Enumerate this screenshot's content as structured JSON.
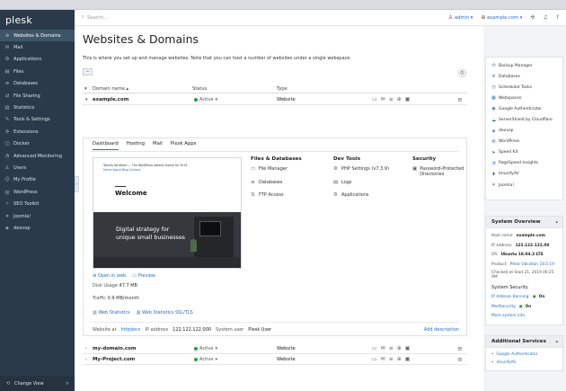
{
  "app": {
    "logo": "plesk"
  },
  "sidebar": {
    "items": [
      {
        "label": "Websites & Domains",
        "icon": "globe-icon",
        "active": true
      },
      {
        "label": "Mail",
        "icon": "mail-icon"
      },
      {
        "label": "Applications",
        "icon": "applications-icon"
      },
      {
        "label": "Files",
        "icon": "files-icon"
      },
      {
        "label": "Databases",
        "icon": "database-icon"
      },
      {
        "label": "File Sharing",
        "icon": "share-icon"
      },
      {
        "label": "Statistics",
        "icon": "statistics-icon"
      },
      {
        "label": "Tools & Settings",
        "icon": "tools-icon"
      },
      {
        "label": "Extensions",
        "icon": "extensions-icon"
      },
      {
        "label": "Docker",
        "icon": "docker-icon"
      },
      {
        "label": "Advanced Monitoring",
        "icon": "monitoring-icon"
      },
      {
        "label": "Users",
        "icon": "users-icon"
      },
      {
        "label": "My Profile",
        "icon": "profile-icon"
      },
      {
        "label": "WordPress",
        "icon": "wordpress-icon"
      },
      {
        "label": "SEO Toolkit",
        "icon": "seo-icon"
      },
      {
        "label": "Joomla!",
        "icon": "joomla-icon"
      },
      {
        "label": "dexvop",
        "icon": "dexvop-icon"
      }
    ],
    "footer_label": "Change View"
  },
  "header": {
    "search_placeholder": "Search...",
    "user": "admin",
    "domain": "example.com"
  },
  "main": {
    "title": "Websites & Domains",
    "intro": "This is where you set up and manage websites. Note that you can host a number of websites under a single webspace.",
    "columns": {
      "name": "Domain name ▴",
      "status": "Status",
      "type": "Type"
    },
    "domains": [
      {
        "name": "example.com",
        "status": "Active",
        "type": "Website",
        "expanded": true
      },
      {
        "name": "my-domain.com",
        "status": "Active",
        "type": "Website"
      },
      {
        "name": "My-Project.com",
        "status": "Active",
        "type": "Website"
      }
    ],
    "panel": {
      "tabs": [
        "Dashboard",
        "Hosting",
        "Mail",
        "Plesk Apps"
      ],
      "preview": {
        "brand": "Twenty Nineteen — The WordPress default theme for 2019",
        "nav": "Home  About  Blog  Contact",
        "welcome": "Welcome",
        "tagline1": "Digital strategy for",
        "tagline2": "unique small businesses"
      },
      "open_in_web": "Open in web",
      "preview_link": "Preview",
      "disk_label": "Disk Usage",
      "disk_value": "47.7 MB",
      "traffic_label": "Traffic",
      "traffic_value": "0.9 MB/month",
      "web_stats": "Web Statistics",
      "web_stats_ssl": "Web Statistics SSL/TLS",
      "website_at_label": "Website at",
      "website_at_value": "httpdocs",
      "ip_label": "IP address",
      "ip_value": "122.122.122.000",
      "sysuser_label": "System user",
      "sysuser_value": "Plesk User",
      "add_description": "Add description",
      "sections": [
        {
          "title": "Files & Databases",
          "items": [
            {
              "label": "File Manager",
              "icon": "folder-icon"
            },
            {
              "label": "Databases",
              "icon": "database-icon"
            },
            {
              "label": "FTP Access",
              "icon": "ftp-icon"
            }
          ]
        },
        {
          "title": "Dev Tools",
          "items": [
            {
              "label": "PHP Settings (v7.3.9)",
              "icon": "php-icon"
            },
            {
              "label": "Logs",
              "icon": "logs-icon"
            },
            {
              "label": "Applications",
              "icon": "applications-icon"
            }
          ]
        },
        {
          "title": "Security",
          "items": [
            {
              "label": "Password-Protected Directories",
              "icon": "lock-folder-icon"
            }
          ]
        }
      ]
    }
  },
  "right": {
    "tools": [
      "Backup Manager",
      "Databases",
      "Scheduled Tasks",
      "Webspaces",
      "Google Authenticator",
      "ServerShield by Cloudflare",
      "dexvop",
      "WordPress",
      "Speed Kit",
      "PageSpeed Insights",
      "ImunifyAV",
      "Joomla!"
    ],
    "overview": {
      "title": "System Overview",
      "hostname_label": "Host name:",
      "hostname_value": "example.com",
      "ip_label": "IP address:",
      "ip_value": "122.122.122.00",
      "os_label": "OS:",
      "os_value": "Ubuntu 18.04.3 LTS",
      "product_label": "Product:",
      "product_value": "Plesk Obsidian 18.0.19",
      "checked": "Checked at Sept 21, 2019 06:25 AM",
      "security_title": "System Security",
      "ip_banning": "IP Address Banning:",
      "ip_banning_state": "On",
      "modsecurity": "ModSecurity:",
      "modsecurity_state": "On",
      "more": "More system info"
    },
    "additional": {
      "title": "Additional Services",
      "items": [
        "Google Authenticator",
        "ImunifyAV"
      ]
    }
  }
}
